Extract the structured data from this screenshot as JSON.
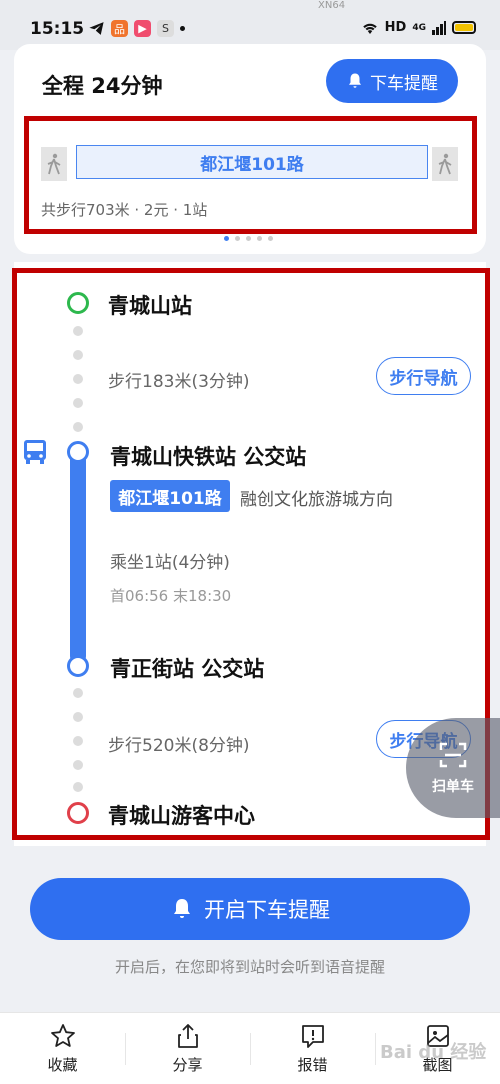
{
  "status_bar": {
    "time": "15:15",
    "network_label": "HD",
    "signal_label": "4G",
    "map_label": "XN64"
  },
  "summary": {
    "title": "全程  24分钟",
    "remind_label": "下车提醒",
    "route_name": "都江堰101路",
    "meta": "共步行703米 · 2元 · 1站"
  },
  "itinerary": {
    "start_stop": "青城山站",
    "walk1_text": "步行183米(3分钟)",
    "walk_nav_label": "步行导航",
    "board_stop": "青城山快铁站 公交站",
    "route_tag": "都江堰101路",
    "direction": "融创文化旅游城方向",
    "ride_text": "乘坐1站(4分钟)",
    "schedule": "首06:56  末18:30",
    "alight_stop": "青正街站 公交站",
    "walk2_text": "步行520米(8分钟)",
    "walk2_nav_label": "步行导航",
    "end_stop": "青城山游客中心"
  },
  "scan": {
    "label": "扫单车"
  },
  "main_action": {
    "label": "开启下车提醒",
    "hint": "开启后，在您即将到站时会听到语音提醒"
  },
  "bottom_tabs": [
    {
      "label": "收藏",
      "icon": "star-icon"
    },
    {
      "label": "分享",
      "icon": "share-icon"
    },
    {
      "label": "报错",
      "icon": "report-icon"
    },
    {
      "label": "截图",
      "icon": "screenshot-icon"
    }
  ],
  "watermark": "Bai du 经验",
  "colors": {
    "accent": "#2f6ff0",
    "highlight_box": "#c00000",
    "start_ring": "#2db84d",
    "end_ring": "#e0404a"
  }
}
